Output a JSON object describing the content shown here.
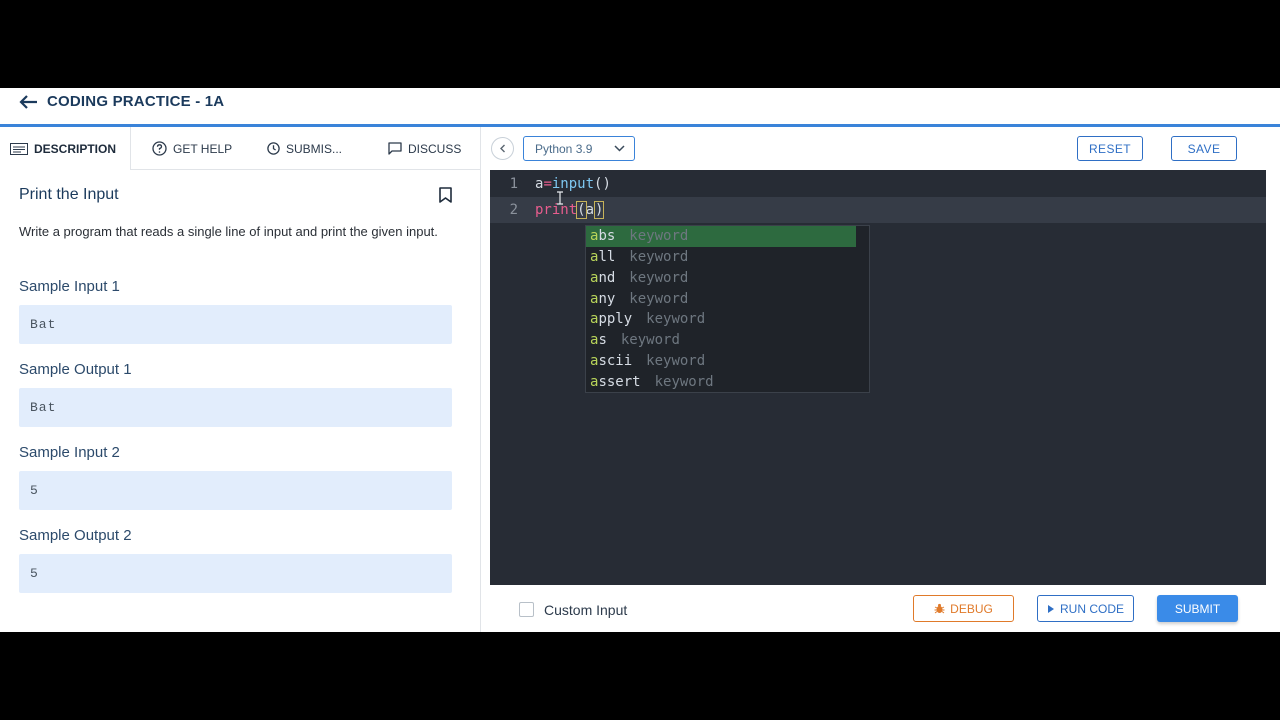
{
  "header": {
    "title": "CODING PRACTICE - 1A"
  },
  "tabs": [
    {
      "label": "DESCRIPTION"
    },
    {
      "label": "GET HELP"
    },
    {
      "label": "SUBMIS..."
    },
    {
      "label": "DISCUSS"
    }
  ],
  "problem": {
    "title": "Print the Input",
    "description": "Write a program that reads a single line of input and print the given input.",
    "samples": [
      {
        "label": "Sample Input 1",
        "value": "Bat"
      },
      {
        "label": "Sample Output 1",
        "value": "Bat"
      },
      {
        "label": "Sample Input 2",
        "value": "5"
      },
      {
        "label": "Sample Output 2",
        "value": "5"
      }
    ]
  },
  "toolbar": {
    "language": "Python 3.9",
    "reset_label": "RESET",
    "save_label": "SAVE"
  },
  "editor": {
    "lines": [
      {
        "num": "1",
        "parts": [
          "a",
          "=",
          "input",
          "()"
        ]
      },
      {
        "num": "2",
        "parts": [
          "print",
          "(",
          "a",
          ")"
        ]
      }
    ],
    "autocomplete": [
      {
        "match": "a",
        "rest": "bs",
        "type": "keyword"
      },
      {
        "match": "a",
        "rest": "ll",
        "type": "keyword"
      },
      {
        "match": "a",
        "rest": "nd",
        "type": "keyword"
      },
      {
        "match": "a",
        "rest": "ny",
        "type": "keyword"
      },
      {
        "match": "a",
        "rest": "pply",
        "type": "keyword"
      },
      {
        "match": "a",
        "rest": "s",
        "type": "keyword"
      },
      {
        "match": "a",
        "rest": "scii",
        "type": "keyword"
      },
      {
        "match": "a",
        "rest": "ssert",
        "type": "keyword"
      }
    ]
  },
  "footer": {
    "custom_input_label": "Custom Input",
    "debug_label": "DEBUG",
    "run_label": "RUN CODE",
    "submit_label": "SUBMIT"
  },
  "colors": {
    "accent": "#3a83d9",
    "debug": "#e07a2a",
    "editor_bg": "#272c35"
  }
}
